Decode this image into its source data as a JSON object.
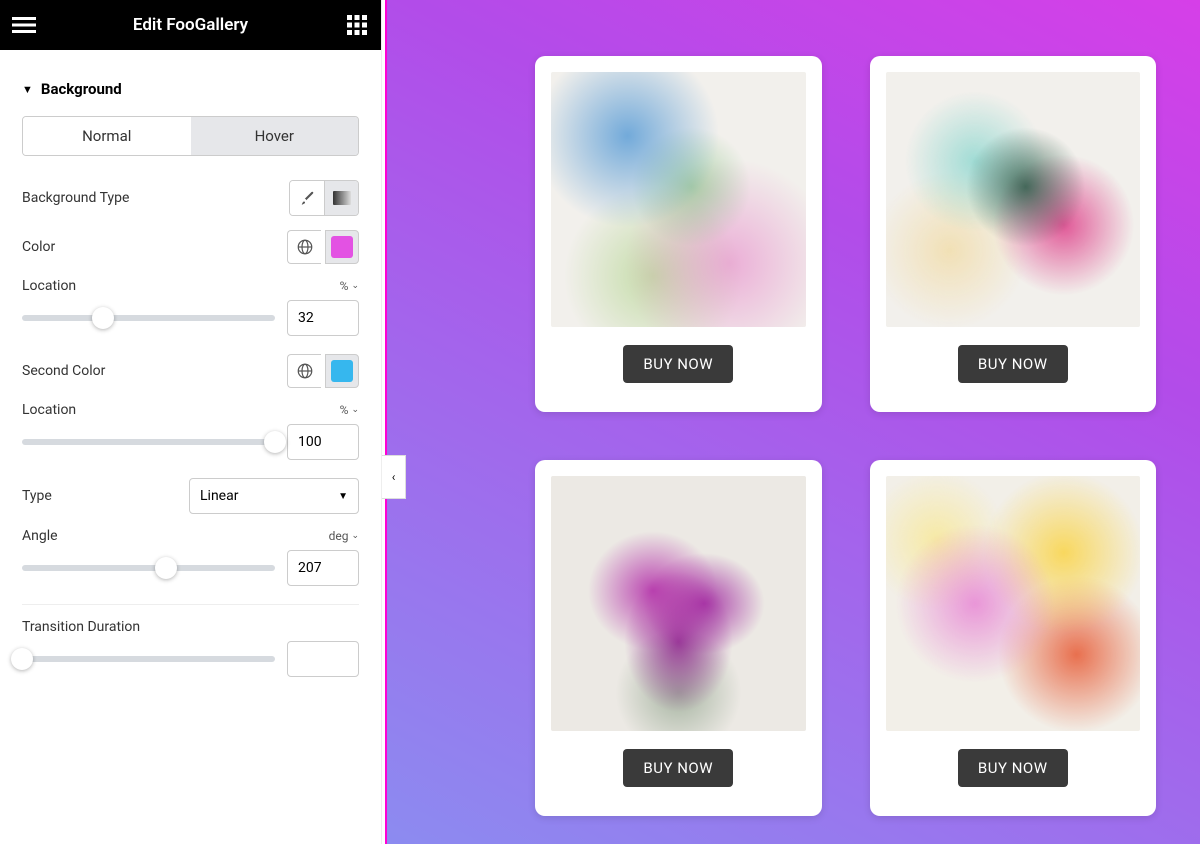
{
  "header": {
    "title": "Edit FooGallery"
  },
  "section": {
    "title": "Background"
  },
  "tabs": {
    "normal": "Normal",
    "hover": "Hover",
    "active": "hover"
  },
  "controls": {
    "bg_type_label": "Background Type",
    "color_label": "Color",
    "color_value": "#e352e3",
    "location1_label": "Location",
    "location1_value": "32",
    "location1_unit": "%",
    "second_color_label": "Second Color",
    "second_color_value": "#36b7ee",
    "location2_label": "Location",
    "location2_value": "100",
    "location2_unit": "%",
    "type_label": "Type",
    "type_value": "Linear",
    "angle_label": "Angle",
    "angle_value": "207",
    "angle_unit": "deg",
    "transition_label": "Transition Duration",
    "transition_value": ""
  },
  "preview": {
    "buy_label": "BUY NOW",
    "gradient_from": "#d63fe8",
    "gradient_to": "#8c8bf0"
  }
}
